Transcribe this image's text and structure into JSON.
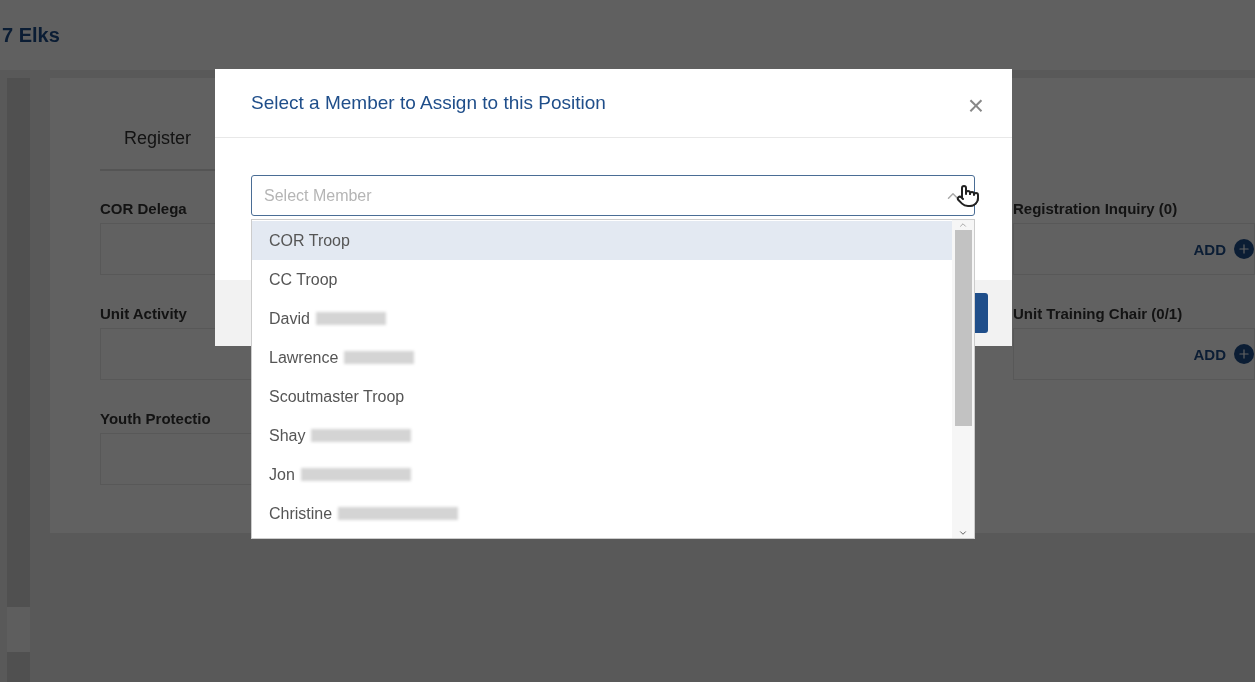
{
  "header": {
    "title": "7 Elks"
  },
  "tabs": [
    {
      "label": "Register",
      "selected": true
    }
  ],
  "positions_left": [
    {
      "title": "COR Delega"
    },
    {
      "title": "Unit Activity"
    },
    {
      "title": "Youth Protectio"
    }
  ],
  "positions_right": [
    {
      "title": "Registration Inquiry (0)",
      "action": "ADD"
    },
    {
      "title": "Unit Training Chair (0/1)",
      "action": "ADD"
    }
  ],
  "dialog": {
    "title": "Select a Member to Assign to this Position",
    "close": "×",
    "select": {
      "placeholder": "Select Member",
      "expanded": true
    },
    "options": [
      {
        "name": "COR Troop",
        "redacted": false,
        "selected": true
      },
      {
        "name": "CC Troop",
        "redacted": false,
        "selected": false
      },
      {
        "name": "David",
        "redacted": true,
        "selected": false
      },
      {
        "name": "Lawrence",
        "redacted": true,
        "selected": false
      },
      {
        "name": "Scoutmaster Troop",
        "redacted": false,
        "selected": false
      },
      {
        "name": "Shay",
        "redacted": true,
        "selected": false
      },
      {
        "name": "Jon",
        "redacted": true,
        "selected": false
      },
      {
        "name": "Christine",
        "redacted": true,
        "selected": false
      }
    ]
  }
}
